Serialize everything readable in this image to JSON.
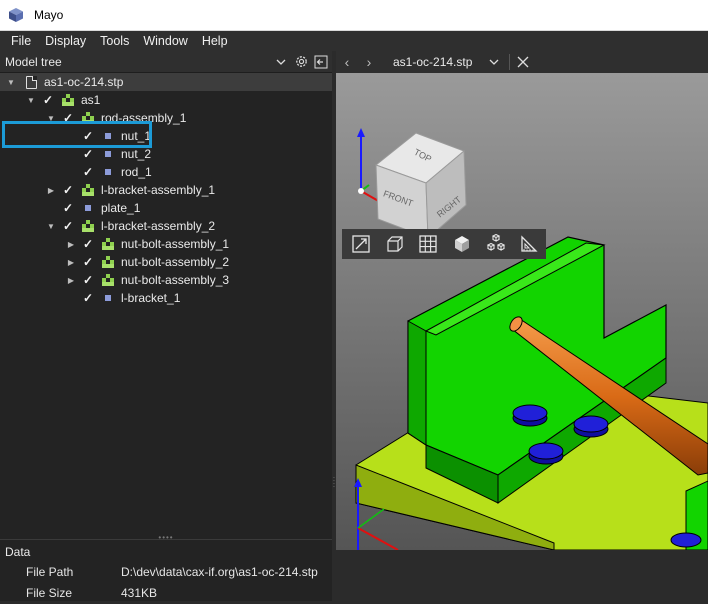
{
  "window": {
    "title": "Mayo"
  },
  "menu": [
    "File",
    "Display",
    "Tools",
    "Window",
    "Help"
  ],
  "left_panel": {
    "header_label": "Model tree",
    "tree": [
      {
        "label": "as1-oc-214.stp",
        "depth": 0,
        "expand": "open",
        "check": false,
        "icon": "file-icon"
      },
      {
        "label": "as1",
        "depth": 1,
        "expand": "open",
        "check": true,
        "icon": "assembly-icon"
      },
      {
        "label": "rod-assembly_1",
        "depth": 2,
        "expand": "open",
        "check": true,
        "icon": "assembly-icon"
      },
      {
        "label": "nut_1",
        "depth": 3,
        "expand": "none",
        "check": true,
        "icon": "part-icon"
      },
      {
        "label": "nut_2",
        "depth": 3,
        "expand": "none",
        "check": true,
        "icon": "part-icon"
      },
      {
        "label": "rod_1",
        "depth": 3,
        "expand": "none",
        "check": true,
        "icon": "part-icon"
      },
      {
        "label": "l-bracket-assembly_1",
        "depth": 2,
        "expand": "closed",
        "check": true,
        "icon": "assembly-icon"
      },
      {
        "label": "plate_1",
        "depth": 2,
        "expand": "none",
        "check": true,
        "icon": "part-icon"
      },
      {
        "label": "l-bracket-assembly_2",
        "depth": 2,
        "expand": "open",
        "check": true,
        "icon": "assembly-icon"
      },
      {
        "label": "nut-bolt-assembly_1",
        "depth": 3,
        "expand": "closed",
        "check": true,
        "icon": "assembly-icon"
      },
      {
        "label": "nut-bolt-assembly_2",
        "depth": 3,
        "expand": "closed",
        "check": true,
        "icon": "assembly-icon"
      },
      {
        "label": "nut-bolt-assembly_3",
        "depth": 3,
        "expand": "closed",
        "check": true,
        "icon": "assembly-icon"
      },
      {
        "label": "l-bracket_1",
        "depth": 3,
        "expand": "none",
        "check": true,
        "icon": "part-icon"
      }
    ],
    "data": {
      "title": "Data",
      "rows": [
        {
          "key": "File Path",
          "value": "D:\\dev\\data\\cax-if.org\\as1-oc-214.stp"
        },
        {
          "key": "File Size",
          "value": "431KB"
        }
      ]
    }
  },
  "right_panel": {
    "tab_name": "as1-oc-214.stp",
    "viewcube": {
      "top": "TOP",
      "front": "FRONT",
      "right": "RIGHT"
    }
  },
  "colors": {
    "accent": "#1c9bd7",
    "green_part": "#12d400",
    "plate": "#b7e01a",
    "rod": "#e0761c",
    "nut": "#1e1ec8"
  }
}
